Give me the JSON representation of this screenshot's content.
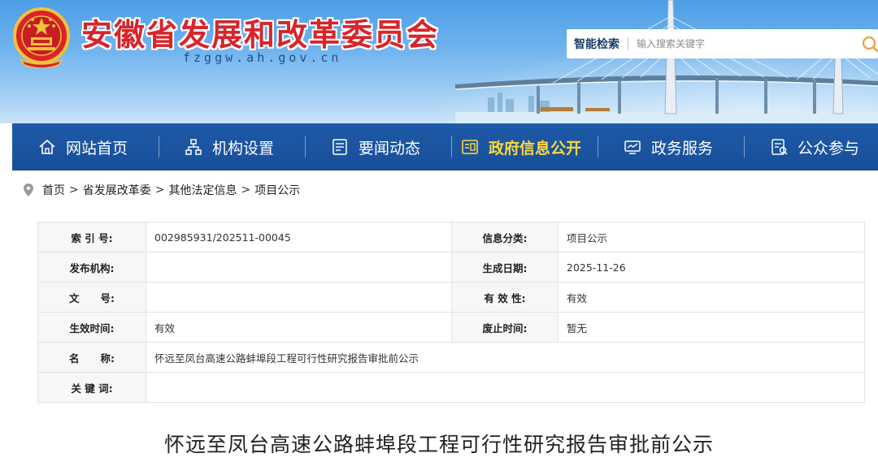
{
  "header": {
    "title": "安徽省发展和改革委员会",
    "domain": "fzggw.ah.gov.cn",
    "emblem_icon": "national-emblem-icon",
    "colors": {
      "title": "#d8242a",
      "sky": "#4d9ee6",
      "nav": "#1e5aa8",
      "active": "#ffd93b"
    }
  },
  "search": {
    "label": "智能检索",
    "placeholder": "输入搜索关键字",
    "icon": "search-icon"
  },
  "nav": {
    "items": [
      {
        "label": "网站首页",
        "icon": "home-icon",
        "active": false
      },
      {
        "label": "机构设置",
        "icon": "org-chart-icon",
        "active": false
      },
      {
        "label": "要闻动态",
        "icon": "news-icon",
        "active": false
      },
      {
        "label": "政府信息公开",
        "icon": "info-disclosure-icon",
        "active": true
      },
      {
        "label": "政务服务",
        "icon": "service-icon",
        "active": false
      },
      {
        "label": "公众参与",
        "icon": "participation-icon",
        "active": false
      }
    ]
  },
  "breadcrumb": {
    "icon": "location-pin-icon",
    "separator": ">",
    "items": [
      "首页",
      "省发展改革委",
      "其他法定信息",
      "项目公示"
    ]
  },
  "info": {
    "index_no": {
      "label": "索 引 号:",
      "value": "002985931/202511-00045"
    },
    "category": {
      "label": "信息分类:",
      "value": "项目公示"
    },
    "publisher": {
      "label": "发布机构:",
      "value": ""
    },
    "created": {
      "label": "生成日期:",
      "value": "2025-11-26"
    },
    "doc_no": {
      "label": "文      号:",
      "value": ""
    },
    "validity": {
      "label": "有 效 性:",
      "value": "有效"
    },
    "effective": {
      "label": "生效时间:",
      "value": "有效"
    },
    "expiry": {
      "label": "废止时间:",
      "value": "暂无"
    },
    "name": {
      "label": "名      称:",
      "value": "怀远至凤台高速公路蚌埠段工程可行性研究报告审批前公示"
    },
    "keywords": {
      "label": "关 键 词:",
      "value": ""
    }
  },
  "article": {
    "title": "怀远至凤台高速公路蚌埠段工程可行性研究报告审批前公示"
  }
}
